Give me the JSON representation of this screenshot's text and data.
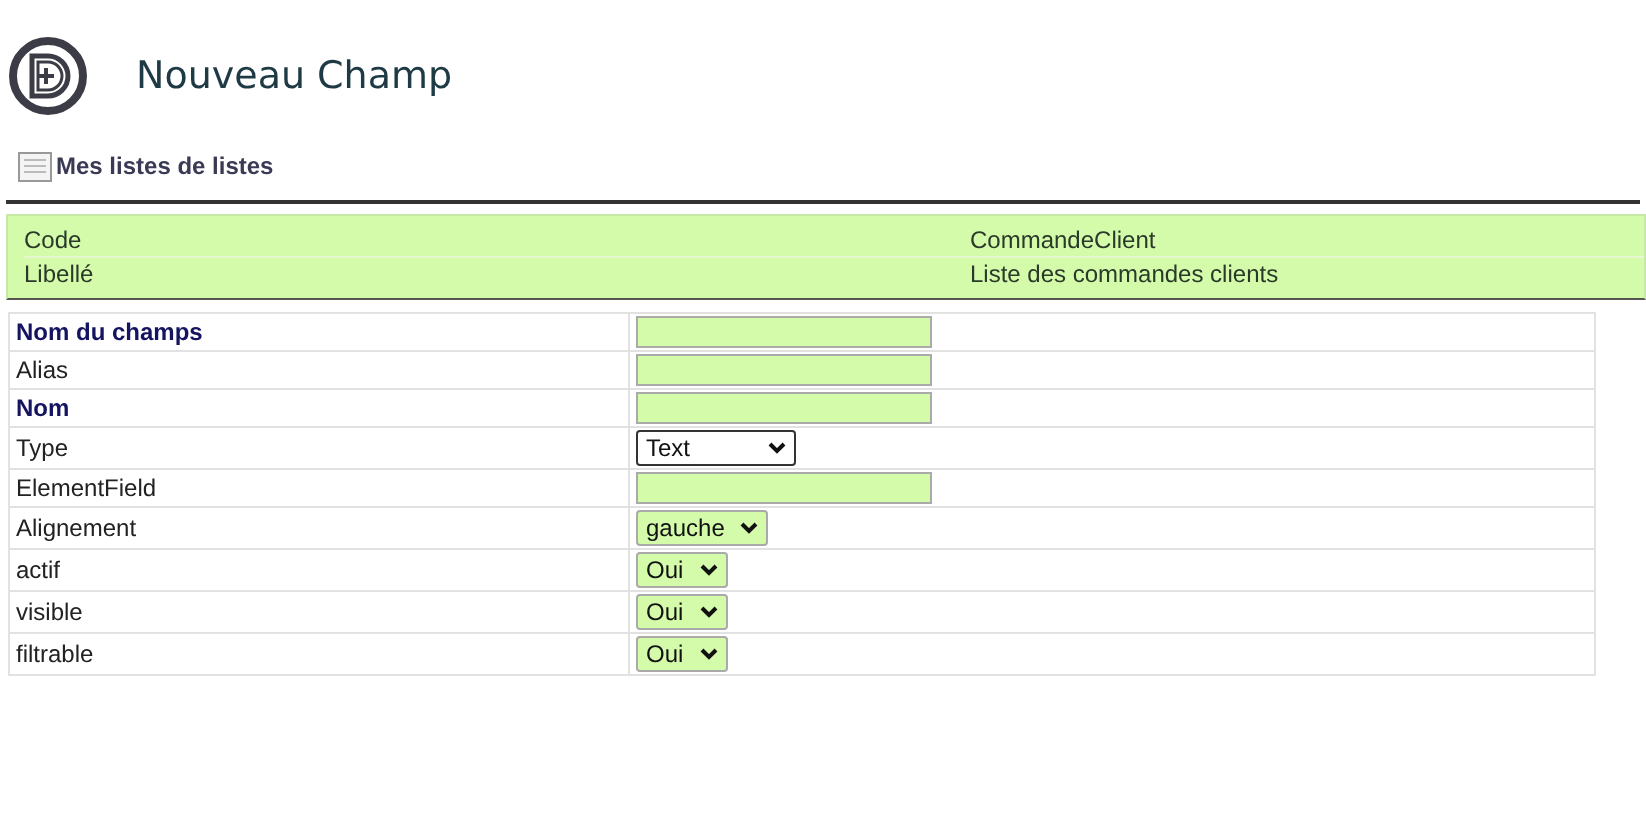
{
  "header": {
    "title": "Nouveau Champ"
  },
  "breadcrumb": {
    "label": "Mes listes de listes"
  },
  "summary": [
    {
      "label": "Code",
      "value": "CommandeClient"
    },
    {
      "label": "Libellé",
      "value": "Liste des commandes clients"
    }
  ],
  "fields": [
    {
      "label": "Nom du champs",
      "required": true,
      "kind": "input"
    },
    {
      "label": "Alias",
      "required": false,
      "kind": "input"
    },
    {
      "label": "Nom",
      "required": true,
      "kind": "input"
    },
    {
      "label": "Type",
      "required": false,
      "kind": "select",
      "value": "Text",
      "tinted": false
    },
    {
      "label": "ElementField",
      "required": false,
      "kind": "input"
    },
    {
      "label": "Alignement",
      "required": false,
      "kind": "select",
      "value": "gauche",
      "tinted": true
    },
    {
      "label": "actif",
      "required": false,
      "kind": "select",
      "value": "Oui",
      "tinted": true
    },
    {
      "label": "visible",
      "required": false,
      "kind": "select",
      "value": "Oui",
      "tinted": true
    },
    {
      "label": "filtrable",
      "required": false,
      "kind": "select",
      "value": "Oui",
      "tinted": true
    }
  ]
}
